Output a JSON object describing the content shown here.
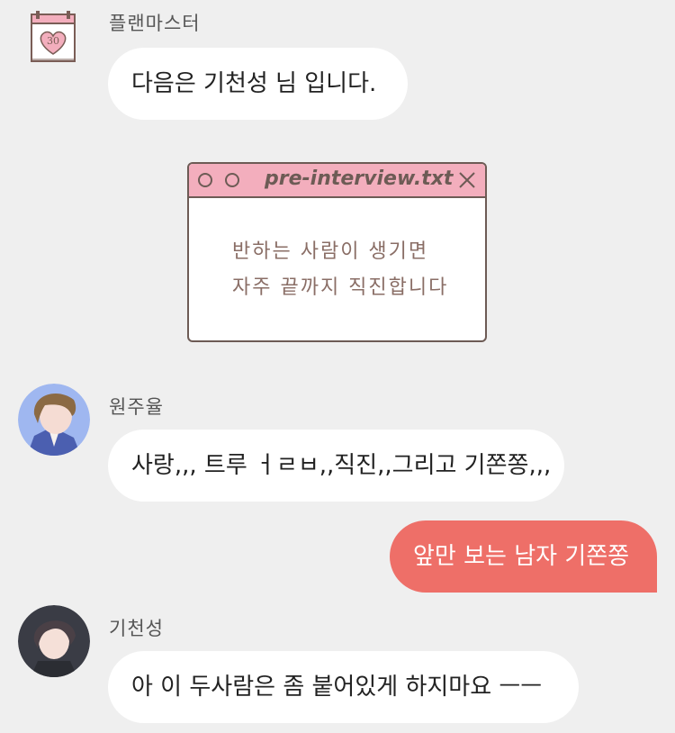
{
  "messages": [
    {
      "sender": "플랜마스터",
      "text": "다음은 기천성 님 입니다."
    },
    {
      "sender": "원주율",
      "text": "사랑,,, 트루 ㅓㄹㅂ,,직진,,그리고 기쫀쫑,,,"
    },
    {
      "text": "앞만 보는 남자 기쫀쫑"
    },
    {
      "sender": "기천성",
      "text": "아 이 두사람은 좀 붙어있게 하지마요 ㅡㅡ"
    }
  ],
  "planmaster_icon": {
    "number": "30",
    "accent": "#f3aebd"
  },
  "notepad": {
    "title": "pre-interview.txt",
    "lines": [
      "반하는 사람이 생기면",
      "자주 끝까지 직진합니다"
    ]
  },
  "colors": {
    "my_bubble": "#ee6f68",
    "background": "#efefef"
  }
}
